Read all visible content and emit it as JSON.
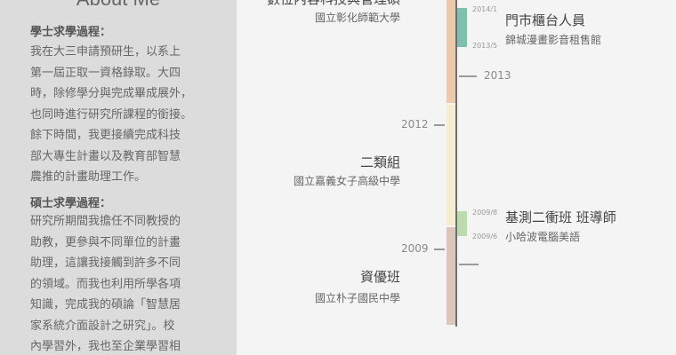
{
  "sidebar": {
    "title": "About Me",
    "sections": [
      {
        "heading": "學士求學過程：",
        "lines": [
          "我在大三申請預研生，以系上",
          "第一屆正取一資格錄取。大四",
          "時，除修學分與完成畢成展外，",
          "也同時進行研究所課程的銜接。",
          "餘下時間，我更接續完成科技",
          "部大專生計畫以及教育部智慧",
          "農推的計畫助理工作。"
        ]
      },
      {
        "heading": "碩士求學過程：",
        "lines": [
          "研究所期間我擔任不同教授的",
          "助教，更參與不同單位的計畫",
          "助理，這讓我接觸到許多不同",
          "的領域。而我也利用所學各項",
          "知識，完成我的碩論「智慧居",
          "家系統介面設計之研究」。校",
          "內學習外，我也至企業學習相"
        ]
      }
    ]
  },
  "timeline": {
    "years": [
      "2013",
      "2012",
      "2009"
    ],
    "colors": {
      "peach": "#edc9ab",
      "cream": "#f6edcf",
      "taupe": "#dcc6ba",
      "line": "#6e6e6e",
      "teal": "#7fbfae",
      "green": "#bcdcb0"
    },
    "education": [
      {
        "title": "數位內容科技與管理碩",
        "school": "國立彰化師範大學"
      },
      {
        "title": "二類組",
        "school": "國立嘉義女子高級中學"
      },
      {
        "title": "資優班",
        "school": "國立朴子國民中學"
      }
    ],
    "work": [
      {
        "title": "門市櫃台人員",
        "org": "錦城漫畫影音租售館",
        "start": "2013/5",
        "end": "2014/1"
      },
      {
        "title": "基測二衝班 班導師",
        "org": "小哈波電腦美語",
        "start": "2009/6",
        "end": "2009/8"
      }
    ]
  }
}
